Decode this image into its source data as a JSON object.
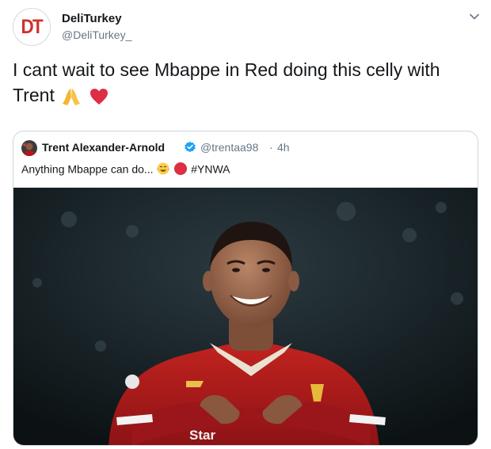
{
  "tweet": {
    "avatar_text": "DT",
    "display_name": "DeliTurkey",
    "handle": "@DeliTurkey_",
    "text": "I cant wait to see Mbappe in Red doing this celly with Trent",
    "emojis": [
      "folded-hands-icon",
      "red-heart-icon"
    ]
  },
  "quoted": {
    "display_name": "Trent Alexander-Arnold",
    "handle": "@trentaa98",
    "separator": "·",
    "time": "4h",
    "text": "Anything Mbappe can do...",
    "hashtag": "#YNWA",
    "image_alt": "Liverpool player smiling with arms crossed",
    "jersey_text": "Star"
  },
  "colors": {
    "text_primary": "#14171a",
    "text_secondary": "#657786",
    "border": "#ccd6dd",
    "verified": "#1da1f2",
    "logo_red": "#d0312d",
    "kit_red": "#a6141a"
  }
}
